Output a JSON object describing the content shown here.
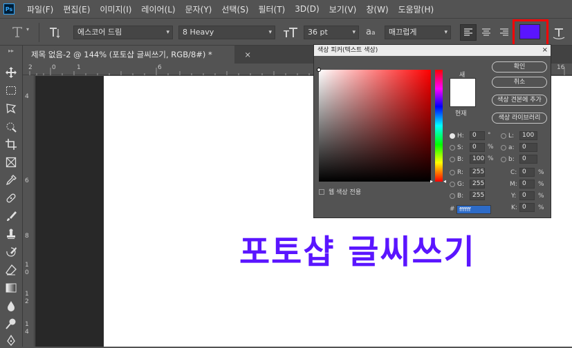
{
  "menu": {
    "logo": "Ps",
    "items": [
      {
        "label": "파일(F)"
      },
      {
        "label": "편집(E)"
      },
      {
        "label": "이미지(I)"
      },
      {
        "label": "레이어(L)"
      },
      {
        "label": "문자(Y)"
      },
      {
        "label": "선택(S)"
      },
      {
        "label": "필터(T)"
      },
      {
        "label": "3D(D)"
      },
      {
        "label": "보기(V)"
      },
      {
        "label": "창(W)"
      },
      {
        "label": "도움말(H)"
      }
    ]
  },
  "options": {
    "font_family": "에스코어 드림",
    "font_style": "8 Heavy",
    "font_size": "36 pt",
    "aa_label": "a",
    "aa_small": "a",
    "antialias": "매끄럽게",
    "text_color": "#5a15ff",
    "highlight_color": "#ff0000"
  },
  "document": {
    "tab_title": "제목 없음-2 @ 144% (포토샵 글씨쓰기, RGB/8#) *",
    "close": "×"
  },
  "rulers": {
    "top": [
      "2",
      "0",
      "1",
      "6",
      "16"
    ],
    "left": [
      "4",
      "6",
      "8",
      "1 0",
      "1 2",
      "1 4"
    ]
  },
  "canvas": {
    "text": "포토샵 글씨쓰기",
    "text_color": "#5a15ff"
  },
  "color_picker": {
    "title": "색상 피커(텍스트 색상)",
    "close": "×",
    "new_label": "새",
    "current_label": "현재",
    "buttons": {
      "ok": "확인",
      "cancel": "취소",
      "add_swatch": "색상 견본에 추가",
      "libraries": "색상 라이브러리"
    },
    "hsb": {
      "h_label": "H:",
      "h": "0",
      "h_unit": "°",
      "s_label": "S:",
      "s": "0",
      "s_unit": "%",
      "b_label": "B:",
      "b": "100",
      "b_unit": "%"
    },
    "rgb": {
      "r_label": "R:",
      "r": "255",
      "g_label": "G:",
      "g": "255",
      "b_label": "B:",
      "b": "255"
    },
    "lab": {
      "l_label": "L:",
      "l": "100",
      "a_label": "a:",
      "a": "0",
      "b_label": "b:",
      "b": "0"
    },
    "cmyk": {
      "c_label": "C:",
      "c": "0",
      "m_label": "M:",
      "m": "0",
      "y_label": "Y:",
      "y": "0",
      "k_label": "K:",
      "k": "0",
      "unit": "%"
    },
    "hex_label": "#",
    "hex": "ffffff",
    "web_only": "웹 색상 전용",
    "swatch_color": "#ffffff"
  }
}
